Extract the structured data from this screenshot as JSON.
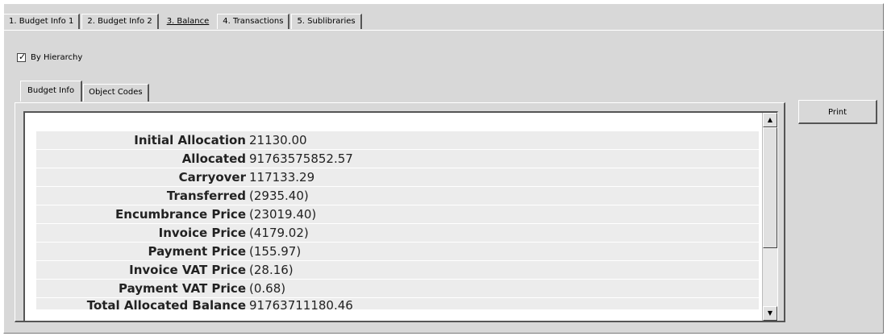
{
  "tabs": [
    {
      "label": "1. Budget Info 1"
    },
    {
      "label": "2. Budget Info 2"
    },
    {
      "label": "3. Balance"
    },
    {
      "label": "4. Transactions"
    },
    {
      "label": "5. Sublibraries"
    }
  ],
  "active_tab": "3. Balance",
  "by_hierarchy": {
    "label": "By Hierarchy",
    "checked": true
  },
  "subtabs": [
    {
      "label": "Budget Info"
    },
    {
      "label": "Object Codes"
    }
  ],
  "balance_rows": [
    {
      "label": "Initial Allocation",
      "value": "21130.00"
    },
    {
      "label": "Allocated",
      "value": "91763575852.57"
    },
    {
      "label": "Carryover",
      "value": "117133.29"
    },
    {
      "label": "Transferred",
      "value": "(2935.40)"
    },
    {
      "label": "Encumbrance Price",
      "value": "(23019.40)"
    },
    {
      "label": "Invoice Price",
      "value": "(4179.02)"
    },
    {
      "label": "Payment Price",
      "value": "(155.97)"
    },
    {
      "label": "Invoice VAT Price",
      "value": "(28.16)"
    },
    {
      "label": "Payment VAT Price",
      "value": "(0.68)"
    },
    {
      "label": "Total Allocated Balance",
      "value": "91763711180.46"
    }
  ],
  "print_button": {
    "label": "Print"
  },
  "icons": {
    "scroll_up": "scroll-up-arrow-icon",
    "scroll_down": "scroll-down-arrow-icon",
    "check": "checkmark-icon"
  }
}
